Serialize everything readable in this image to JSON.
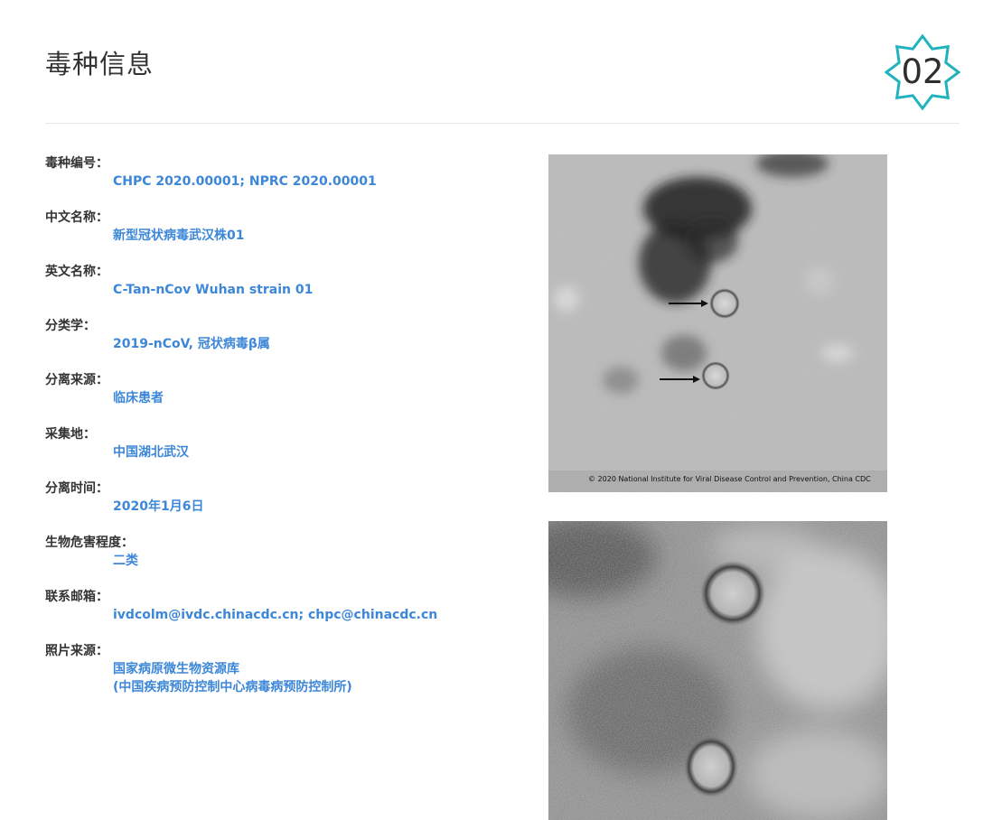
{
  "header": {
    "title": "毒种信息",
    "badge_number": "02",
    "badge_color": "#1fb3bd"
  },
  "fields": [
    {
      "label": "毒种编号：",
      "values": [
        "CHPC 2020.00001; NPRC 2020.00001"
      ]
    },
    {
      "label": "中文名称：",
      "values": [
        "新型冠状病毒武汉株01"
      ]
    },
    {
      "label": "英文名称：",
      "values": [
        "C-Tan-nCov Wuhan strain 01"
      ]
    },
    {
      "label": "分类学：",
      "values": [
        "2019-nCoV, 冠状病毒β属"
      ]
    },
    {
      "label": "分离来源：",
      "values": [
        "临床患者"
      ]
    },
    {
      "label": "采集地：",
      "values": [
        "中国湖北武汉"
      ]
    },
    {
      "label": "分离时间：",
      "values": [
        "2020年1月6日"
      ]
    },
    {
      "label": "生物危害程度：",
      "values": [
        "二类"
      ]
    },
    {
      "label": "联系邮箱：",
      "values": [
        "ivdcolm@ivdc.chinacdc.cn; chpc@chinacdc.cn"
      ]
    },
    {
      "label": "照片来源：",
      "values": [
        "国家病原微生物资源库",
        "(中国疾病预防控制中心病毒病预防控制所)"
      ]
    }
  ],
  "photos": {
    "photo1_caption": "© 2020 National Institute for Viral Disease Control and Prevention, China CDC"
  },
  "colors": {
    "label": "#333333",
    "value": "#3d87d8",
    "divider": "#e6e6e6"
  }
}
